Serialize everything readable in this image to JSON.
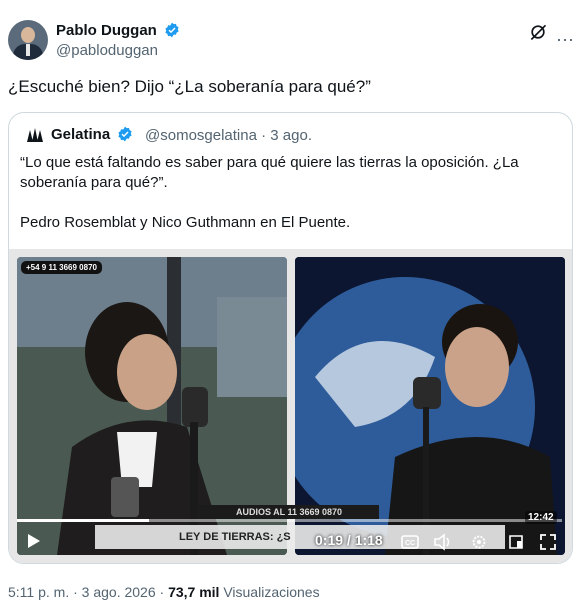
{
  "author": {
    "name": "Pablo Duggan",
    "handle": "@pabloduggan"
  },
  "tweet": {
    "text": "¿Escuché bien? Dijo “¿La soberanía para qué?”"
  },
  "quote": {
    "name": "Gelatina",
    "handle_date": "@somosgelatina · 3 ago.",
    "text": "“Lo que está faltando es saber para qué quiere las tierras la oposición. ¿La soberanía para qué?”.\n\nPedro Rosemblat y Nico Guthmann en El Puente."
  },
  "video": {
    "phone_badge": "+54 9 11 3669 0870",
    "ticker_top": "AUDIOS AL 11 3669 0870",
    "ticker_text": "LEY DE TIERRAS: ¿S",
    "time": "0:19 / 1:18",
    "corner_time": "12:42",
    "progress": 0.243
  },
  "meta": {
    "time_date": "5:11 p. m. · 3 ago. 2026 · ",
    "views": "73,7 mil",
    "views_label": " Visualizaciones"
  },
  "colors": {
    "verified": "#1d9bf0",
    "muted": "#536471",
    "border": "#cfd9de"
  }
}
